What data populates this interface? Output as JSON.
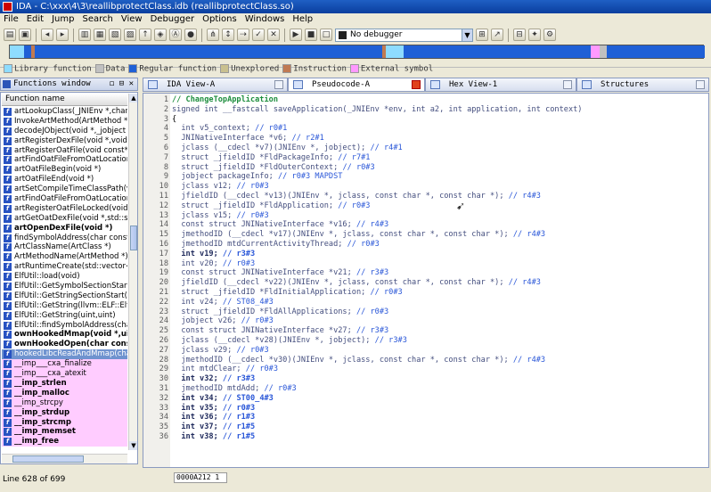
{
  "window": {
    "title": "IDA - C:\\xxx\\4\\3\\reallibprotectClass.idb (reallibprotectClass.so)"
  },
  "menu": [
    "File",
    "Edit",
    "Jump",
    "Search",
    "View",
    "Debugger",
    "Options",
    "Windows",
    "Help"
  ],
  "toolbar": {
    "debugger_value": "No debugger"
  },
  "legend": [
    {
      "label": "Library function",
      "color": "#8edcff"
    },
    {
      "label": "Data",
      "color": "#c0c0c0"
    },
    {
      "label": "Regular function",
      "color": "#1f60d6"
    },
    {
      "label": "Unexplored",
      "color": "#c9c08f"
    },
    {
      "label": "Instruction",
      "color": "#c07a52"
    },
    {
      "label": "External symbol",
      "color": "#ff99ff"
    }
  ],
  "functions_window": {
    "title": "Functions window",
    "column": "Function name",
    "status": "Line 628 of 699",
    "items": [
      {
        "name": "artLookupClass(_JNIEnv *,char co",
        "style": "normal"
      },
      {
        "name": "InvokeArtMethod(ArtMethod *,vo",
        "style": "normal"
      },
      {
        "name": "decodeJObject(void *,_jobject *)",
        "style": "normal"
      },
      {
        "name": "artRegisterDexFile(void *,void cor",
        "style": "normal"
      },
      {
        "name": "artRegisterOatFile(void const*)",
        "style": "normal"
      },
      {
        "name": "artFindOatFileFromOatLocation(vo",
        "style": "normal"
      },
      {
        "name": "artOatFileBegin(void *)",
        "style": "normal"
      },
      {
        "name": "artOatFileEnd(void *)",
        "style": "normal"
      },
      {
        "name": "artSetCompileTimeClassPath(void",
        "style": "normal"
      },
      {
        "name": "artFindOatFileFromOatLocationLoc",
        "style": "normal"
      },
      {
        "name": "artRegisterOatFileLocked(void cor",
        "style": "normal"
      },
      {
        "name": "artGetOatDexFile(void *,std::strin",
        "style": "normal"
      },
      {
        "name": "artOpenDexFile(void *)",
        "style": "bold"
      },
      {
        "name": "findSymbolAddress(char const*)",
        "style": "normal"
      },
      {
        "name": "ArtClassName(ArtClass *)",
        "style": "normal"
      },
      {
        "name": "ArtMethodName(ArtMethod *)",
        "style": "normal"
      },
      {
        "name": "artRuntimeCreate(std::vector<std",
        "style": "normal"
      },
      {
        "name": "ElfUtil::load(void)",
        "style": "normal"
      },
      {
        "name": "ElfUtil::GetSymbolSectionStart(uin",
        "style": "normal"
      },
      {
        "name": "ElfUtil::GetStringSectionStart(uint",
        "style": "normal"
      },
      {
        "name": "ElfUtil::GetString(llvm::ELF::Elf32_",
        "style": "normal"
      },
      {
        "name": "ElfUtil::GetString(uint,uint)",
        "style": "normal"
      },
      {
        "name": "ElfUtil::findSymbolAddress(char co",
        "style": "normal"
      },
      {
        "name": "ownHookedMmap(void *,uint",
        "style": "bold"
      },
      {
        "name": "ownHookedOpen(char const*",
        "style": "bold"
      },
      {
        "name": "hookedLibcReadAndMmap(char co",
        "style": "sel"
      },
      {
        "name": "__imp___cxa_finalize",
        "style": "pink"
      },
      {
        "name": "__imp___cxa_atexit",
        "style": "pink"
      },
      {
        "name": "__imp_strlen",
        "style": "pinkbold"
      },
      {
        "name": "__imp_malloc",
        "style": "pinkbold"
      },
      {
        "name": "__imp_strcpy",
        "style": "pink"
      },
      {
        "name": "__imp_strdup",
        "style": "pinkbold"
      },
      {
        "name": "__imp_strcmp",
        "style": "pinkbold"
      },
      {
        "name": "__imp_memset",
        "style": "pinkbold"
      },
      {
        "name": "__imp_free",
        "style": "pinkbold"
      }
    ]
  },
  "tabs": [
    {
      "label": "IDA View-A",
      "close_red": false
    },
    {
      "label": "Pseudocode-A",
      "close_red": true
    },
    {
      "label": "Hex View-1",
      "close_red": false
    },
    {
      "label": "Structures",
      "close_red": false
    }
  ],
  "pseudocode": {
    "lines": [
      {
        "n": "1",
        "code": "// ChangeTopApplication",
        "comment": "",
        "style": "comment"
      },
      {
        "n": "2",
        "code": "signed int __fastcall saveApplication(_JNIEnv *env, int a2, int application, int context)",
        "comment": "",
        "style": "normal"
      },
      {
        "n": "3",
        "code": "{",
        "comment": "",
        "style": "brace"
      },
      {
        "n": "4",
        "code": "  int v5_context; ",
        "comment": "// r0#1",
        "style": "normal"
      },
      {
        "n": "5",
        "code": "  JNINativeInterface *v6; ",
        "comment": "// r2#1",
        "style": "normal"
      },
      {
        "n": "6",
        "code": "  jclass (__cdecl *v7)(JNIEnv *, jobject); ",
        "comment": "// r4#1",
        "style": "normal"
      },
      {
        "n": "7",
        "code": "  struct _jfieldID *FldPackageInfo; ",
        "comment": "// r7#1",
        "style": "normal"
      },
      {
        "n": "8",
        "code": "  struct _jfieldID *FldOuterContext; ",
        "comment": "// r0#3",
        "style": "normal"
      },
      {
        "n": "9",
        "code": "  jobject packageInfo; ",
        "comment": "// r0#3 MAPDST",
        "style": "normal"
      },
      {
        "n": "10",
        "code": "  jclass v12; ",
        "comment": "// r0#3",
        "style": "normal"
      },
      {
        "n": "11",
        "code": "  jfieldID (__cdecl *v13)(JNIEnv *, jclass, const char *, const char *); ",
        "comment": "// r4#3",
        "style": "normal"
      },
      {
        "n": "12",
        "code": "  struct _jfieldID *FldApplication; ",
        "comment": "// r0#3",
        "style": "normal"
      },
      {
        "n": "13",
        "code": "  jclass v15; ",
        "comment": "// r0#3",
        "style": "normal"
      },
      {
        "n": "14",
        "code": "  const struct JNINativeInterface *v16; ",
        "comment": "// r4#3",
        "style": "normal"
      },
      {
        "n": "15",
        "code": "  jmethodID (__cdecl *v17)(JNIEnv *, jclass, const char *, const char *); ",
        "comment": "// r4#3",
        "style": "normal"
      },
      {
        "n": "16",
        "code": "  jmethodID mtdCurrentActivityThread; ",
        "comment": "// r0#3",
        "style": "normal"
      },
      {
        "n": "17",
        "code": "  int v19; ",
        "comment": "// r3#3",
        "style": "bold"
      },
      {
        "n": "18",
        "code": "  int v20; ",
        "comment": "// r0#3",
        "style": "normal"
      },
      {
        "n": "19",
        "code": "  const struct JNINativeInterface *v21; ",
        "comment": "// r3#3",
        "style": "normal"
      },
      {
        "n": "20",
        "code": "  jfieldID (__cdecl *v22)(JNIEnv *, jclass, const char *, const char *); ",
        "comment": "// r4#3",
        "style": "normal"
      },
      {
        "n": "21",
        "code": "  struct _jfieldID *FldInitialApplication; ",
        "comment": "// r0#3",
        "style": "normal"
      },
      {
        "n": "22",
        "code": "  int v24; ",
        "comment": "// ST08_4#3",
        "style": "normal"
      },
      {
        "n": "23",
        "code": "  struct _jfieldID *FldAllApplications; ",
        "comment": "// r0#3",
        "style": "normal"
      },
      {
        "n": "24",
        "code": "  jobject v26; ",
        "comment": "// r0#3",
        "style": "normal"
      },
      {
        "n": "25",
        "code": "  const struct JNINativeInterface *v27; ",
        "comment": "// r3#3",
        "style": "normal"
      },
      {
        "n": "26",
        "code": "  jclass (__cdecl *v28)(JNIEnv *, jobject); ",
        "comment": "// r3#3",
        "style": "normal"
      },
      {
        "n": "27",
        "code": "  jclass v29; ",
        "comment": "// r0#3",
        "style": "normal"
      },
      {
        "n": "28",
        "code": "  jmethodID (__cdecl *v30)(JNIEnv *, jclass, const char *, const char *); ",
        "comment": "// r4#3",
        "style": "normal"
      },
      {
        "n": "29",
        "code": "  int mtdClear; ",
        "comment": "// r0#3",
        "style": "normal"
      },
      {
        "n": "30",
        "code": "  int v32; ",
        "comment": "// r3#3",
        "style": "bold"
      },
      {
        "n": "31",
        "code": "  jmethodID mtdAdd; ",
        "comment": "// r0#3",
        "style": "normal"
      },
      {
        "n": "32",
        "code": "  int v34; ",
        "comment": "// ST00_4#3",
        "style": "bold"
      },
      {
        "n": "33",
        "code": "  int v35; ",
        "comment": "// r0#3",
        "style": "bold"
      },
      {
        "n": "34",
        "code": "  int v36; ",
        "comment": "// r1#3",
        "style": "bold"
      },
      {
        "n": "35",
        "code": "  int v37; ",
        "comment": "// r1#5",
        "style": "bold"
      },
      {
        "n": "36",
        "code": "  int v38; ",
        "comment": "// r1#5",
        "style": "bold"
      }
    ],
    "status_address": "0000A212 1"
  }
}
